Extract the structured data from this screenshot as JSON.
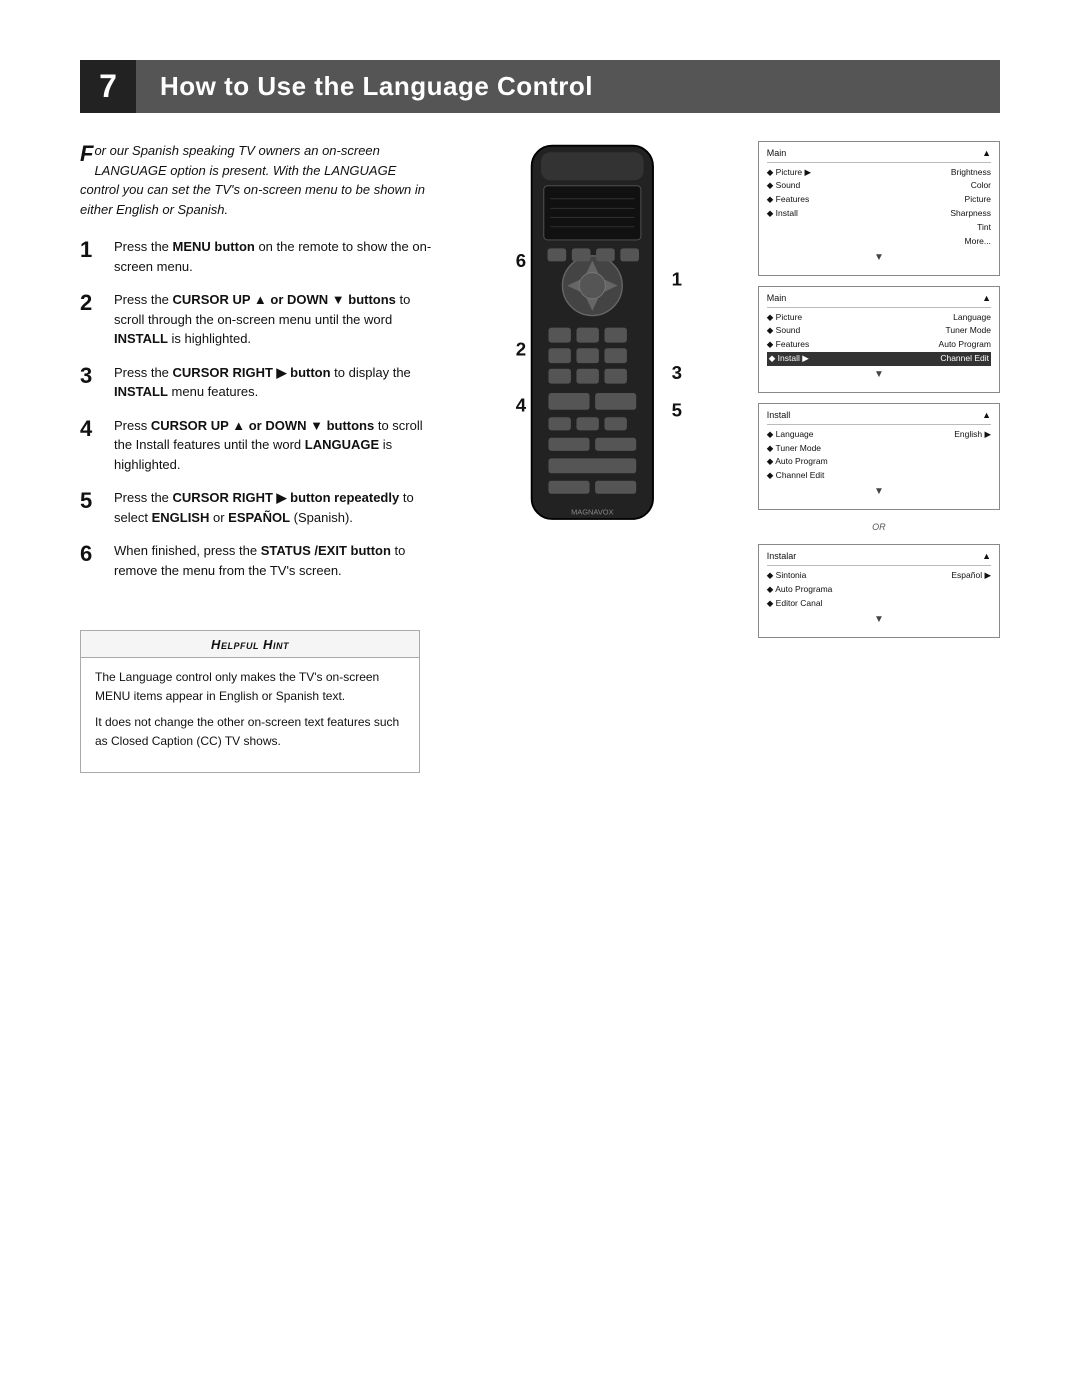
{
  "page": {
    "title_number": "7",
    "title_text": "How to Use the Language Control"
  },
  "intro": {
    "text": "or our Spanish speaking TV owners an on-screen LANGUAGE option is present. With the LANGUAGE control you can set the TV's on-screen menu to be shown in either English or Spanish.",
    "drop_cap": "F"
  },
  "steps": [
    {
      "number": "1",
      "html": "Press the <b>MENU button</b> on the remote to show the on-screen menu."
    },
    {
      "number": "2",
      "html": "Press the <b>CURSOR UP ▲ or DOWN ▼ buttons</b> to scroll through the on-screen menu until the word <b>INSTALL</b> is highlighted."
    },
    {
      "number": "3",
      "html": "Press the <b>CURSOR RIGHT ▶ button</b> to display the <b>INSTALL</b> menu features."
    },
    {
      "number": "4",
      "html": "Press <b>CURSOR UP ▲ or DOWN ▼ buttons</b> to scroll the Install features until the word <b>LANGUAGE</b> is highlighted."
    },
    {
      "number": "5",
      "html": "Press the <b>CURSOR RIGHT ▶ button repeatedly</b> to select <b>ENGLISH</b> or <b>ESPAÑOL</b> (Spanish)."
    },
    {
      "number": "6",
      "html": "When finished, press the <b>STATUS /EXIT button</b> to remove the menu from the TV's screen."
    }
  ],
  "screens": [
    {
      "id": "screen1",
      "title": "Main",
      "rows": [
        {
          "label": "◆ Picture",
          "value": "Brightness",
          "selected": false
        },
        {
          "label": "◆ Sound",
          "value": "Color",
          "selected": false
        },
        {
          "label": "◆ Features",
          "value": "Picture",
          "selected": false
        },
        {
          "label": "◆ Install",
          "value": "Sharpness",
          "selected": false
        },
        {
          "label": "",
          "value": "Tint",
          "selected": false
        },
        {
          "label": "",
          "value": "More...",
          "selected": false
        }
      ]
    },
    {
      "id": "screen2",
      "title": "Main",
      "rows": [
        {
          "label": "◆ Picture",
          "value": "Language",
          "selected": false
        },
        {
          "label": "◆ Sound",
          "value": "Tuner Mode",
          "selected": false
        },
        {
          "label": "◆ Features",
          "value": "Auto Program",
          "selected": false
        },
        {
          "label": "◆ Install ▶",
          "value": "Channel Edit",
          "selected": true
        }
      ]
    },
    {
      "id": "screen3",
      "title": "Install",
      "rows": [
        {
          "label": "◆ Language",
          "value": "English ▶",
          "selected": false
        },
        {
          "label": "◆ Tuner Mode",
          "value": "",
          "selected": false
        },
        {
          "label": "◆ Auto Program",
          "value": "",
          "selected": false
        },
        {
          "label": "◆ Channel Edit",
          "value": "",
          "selected": false
        }
      ]
    },
    {
      "id": "screen4",
      "title": "Instalar",
      "rows": [
        {
          "label": "◆ Sintonia",
          "value": "Español ▶",
          "selected": false
        },
        {
          "label": "◆ Auto Programa",
          "value": "",
          "selected": false
        },
        {
          "label": "◆ Editor Canal",
          "value": "",
          "selected": false
        }
      ]
    }
  ],
  "hint": {
    "title": "Helpful Hint",
    "paragraphs": [
      "The Language control only makes the TV's on-screen MENU items appear in English or Spanish text.",
      "It does not change the other on-screen text features such as Closed Caption (CC) TV shows."
    ]
  },
  "step_labels_on_remote": [
    "6",
    "1",
    "2",
    "3",
    "4",
    "5"
  ],
  "brand": "MAGNAVOX"
}
